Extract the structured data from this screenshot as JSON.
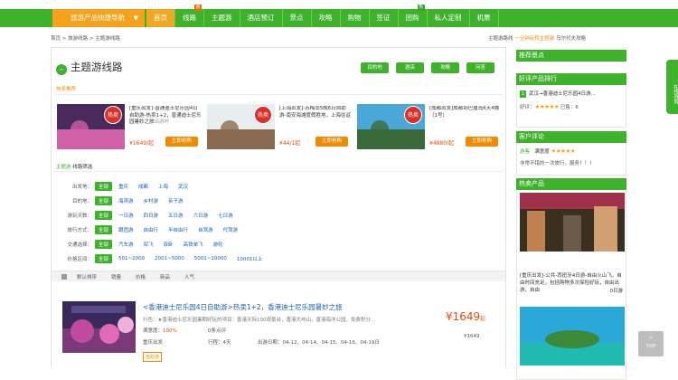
{
  "nav": {
    "category_label": "旅游产品快捷导航",
    "items": [
      "首页",
      "线路",
      "主题游",
      "酒店预订",
      "景点",
      "攻略",
      "购物",
      "签证",
      "团购",
      "私人定制",
      "机票"
    ],
    "badges": [
      {
        "text": "惠",
        "color": "#f06a00"
      },
      {
        "text": "热",
        "color": "#2fa52b"
      }
    ]
  },
  "breadcrumb": "首页 > 旅游线路 > 主题游线路",
  "toplinks": {
    "a": "主题游路线",
    "b": "一分钟玩转主题游",
    "c": "乌尔代夫攻略"
  },
  "title": "主题游线路",
  "title_buttons": [
    "目的地",
    "酒店",
    "攻略",
    "问答"
  ],
  "hot_label": "热卖推荐",
  "hot_products": [
    {
      "seal": "热卖",
      "text": "[重庆出发]-普通迪士尼乐园4日自助游-热卖1+2，普通迪士尼乐园暑妙之旅",
      "tail": "出游时",
      "price": "¥1649/起",
      "buy": "立即抢购"
    },
    {
      "seal": "热卖",
      "text": "[上海出发]-苏梅岛5晚6日自助游-南安海滩度假胜地，上海往返",
      "tail": "",
      "price": "¥44/1起",
      "buy": "立即抢购"
    },
    {
      "seal": "热卖",
      "text": "[成都出发]成都到巴厘岛6天4晚（1号）",
      "tail": "",
      "price": "¥4880/起",
      "buy": "立即抢购"
    }
  ],
  "filter": {
    "head_a": "主题游",
    "head_b": "线路筛选",
    "rows": [
      {
        "label": "出发地：",
        "tags": [
          "全部",
          "重庆",
          "成都",
          "上海",
          "武汉"
        ]
      },
      {
        "label": "目的地：",
        "tags": [
          "全部",
          "海滨游",
          "乡村游",
          "亲子游"
        ]
      },
      {
        "label": "游玩天数：",
        "tags": [
          "全部",
          "一日游",
          "四日游",
          "五日游",
          "六日游",
          "七日游"
        ]
      },
      {
        "label": "旅行方式：",
        "tags": [
          "全部",
          "跟团游",
          "自由行",
          "半自由行",
          "自驾游",
          "代驾游"
        ]
      },
      {
        "label": "交通选择：",
        "tags": [
          "全部",
          "汽车游",
          "双飞",
          "双卧",
          "高铁单飞",
          "游轮"
        ]
      },
      {
        "label": "价格区间：",
        "tags": [
          "全部",
          "501~2000",
          "2001~5000",
          "5001~10000",
          "10001以上"
        ]
      }
    ]
  },
  "sort": [
    "默认排序",
    "销量",
    "价格",
    "新品",
    "人气"
  ],
  "result": {
    "title": "<香港迪士尼乐园4日自助游>热卖1+2，香港迪士尼乐园暑妙之旅",
    "desc_label": "行色：",
    "desc": "★香港迪士尼乐园暑期好玩的项目：香港天际100观景台，香港大屿山，香港海洋公园，免费积分...",
    "satisfaction_label": "满意度：",
    "satisfaction": "100%",
    "reviews": "0条点评",
    "origin": "重庆出发",
    "days": "行程：4天",
    "dates": "出游日期：04-12、04-14、04-15、04-16、04-19日",
    "price": "¥1649",
    "price_unit": "起",
    "old": "¥1649",
    "tag": "自助游"
  },
  "sidebar": {
    "recommend": "推荐景点",
    "rank_title": "好评产品排行",
    "rank_item": "武汉→香港迪士尼乐园4日游...",
    "rank_rating": "好评：",
    "rank_count": "已售：6",
    "review_title": "客户评论",
    "review_user": "游客",
    "review_label": "满意度",
    "review_text": "非常不错的一次旅行，服务！！！",
    "hot_title": "热卖产品",
    "hot_item": "[重庆出发]-公共-西班牙4日游-自由火山飞，自由时间充足，包括购物多次探险好玩，自由出游，自由",
    "hot_count": "0日游"
  },
  "float_label": "在线咨询",
  "top_label": "TOP"
}
